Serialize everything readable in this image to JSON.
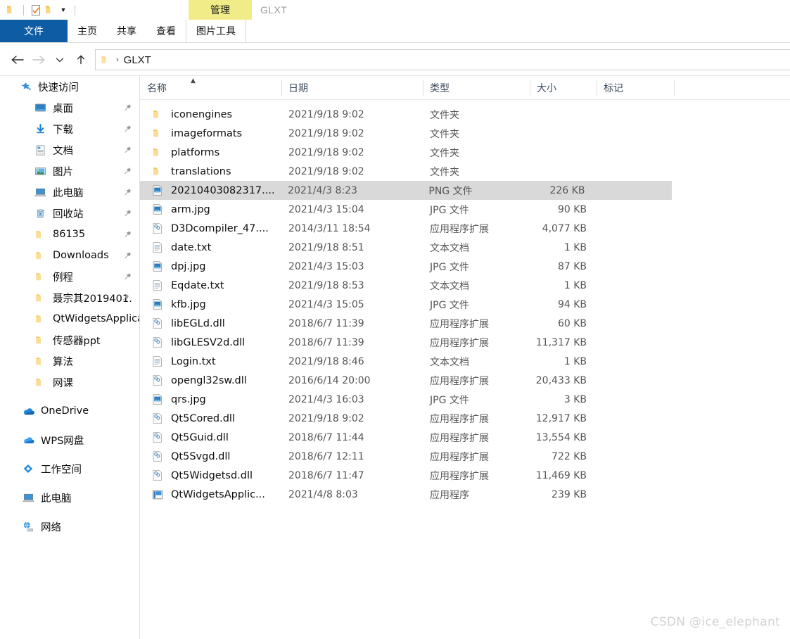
{
  "window": {
    "title": "GLXT",
    "contextual_tab_group": "管理"
  },
  "quick_access_toolbar": {
    "items": [
      {
        "name": "folder-icon",
        "label": "属性"
      },
      {
        "name": "properties-icon",
        "label": "属性"
      },
      {
        "name": "new-folder-icon",
        "label": "新建文件夹"
      }
    ],
    "customize_label": "自定义快速访问工具栏"
  },
  "ribbon": {
    "tabs": [
      {
        "label": "文件",
        "active": true
      },
      {
        "label": "主页",
        "active": false
      },
      {
        "label": "共享",
        "active": false
      },
      {
        "label": "查看",
        "active": false
      },
      {
        "label": "图片工具",
        "active": false,
        "contextual": true
      }
    ],
    "accent_blue": "#0d5ca4",
    "contextual_yellow": "#f1ec88"
  },
  "navigation": {
    "back_label": "后退",
    "forward_label": "前进",
    "recent_label": "最近浏览的位置",
    "up_label": "上移一级",
    "address": {
      "crumb": "GLXT",
      "separator": "›"
    }
  },
  "sidebar": {
    "groups": [
      {
        "root": {
          "label": "快速访问",
          "icon": "star-pin-icon"
        },
        "items": [
          {
            "label": "桌面",
            "icon": "desktop-icon",
            "pinned": true
          },
          {
            "label": "下载",
            "icon": "downloads-icon",
            "pinned": true
          },
          {
            "label": "文档",
            "icon": "documents-icon",
            "pinned": true
          },
          {
            "label": "图片",
            "icon": "pictures-icon",
            "pinned": true
          },
          {
            "label": "此电脑",
            "icon": "this-pc-icon",
            "pinned": true
          },
          {
            "label": "回收站",
            "icon": "recycle-bin-icon",
            "pinned": true
          },
          {
            "label": "86135",
            "icon": "folder-icon",
            "pinned": true
          },
          {
            "label": "Downloads",
            "icon": "folder-icon",
            "pinned": true
          },
          {
            "label": "例程",
            "icon": "folder-icon",
            "pinned": true
          },
          {
            "label": "聂宗其2019401…",
            "icon": "folder-icon",
            "pinned": true
          },
          {
            "label": "QtWidgetsApplica",
            "icon": "folder-icon",
            "pinned": false
          },
          {
            "label": "传感器ppt",
            "icon": "folder-icon",
            "pinned": false
          },
          {
            "label": "算法",
            "icon": "folder-icon",
            "pinned": false
          },
          {
            "label": "网课",
            "icon": "folder-icon",
            "pinned": false
          }
        ]
      },
      {
        "root": {
          "label": "OneDrive",
          "icon": "onedrive-icon"
        },
        "items": []
      },
      {
        "root": {
          "label": "WPS网盘",
          "icon": "wps-cloud-icon"
        },
        "items": []
      },
      {
        "root": {
          "label": "工作空间",
          "icon": "workspace-icon"
        },
        "items": []
      },
      {
        "root": {
          "label": "此电脑",
          "icon": "this-pc-icon"
        },
        "items": []
      },
      {
        "root": {
          "label": "网络",
          "icon": "network-icon"
        },
        "items": []
      }
    ]
  },
  "file_list": {
    "columns": [
      {
        "label": "名称",
        "key": "name",
        "sorted": "asc"
      },
      {
        "label": "日期",
        "key": "date"
      },
      {
        "label": "类型",
        "key": "type"
      },
      {
        "label": "大小",
        "key": "size"
      },
      {
        "label": "标记",
        "key": "tag"
      }
    ],
    "rows": [
      {
        "name": "iconengines",
        "date": "2021/9/18 9:02",
        "type": "文件夹",
        "size": "",
        "tag": "",
        "icon": "folder-icon",
        "selected": false
      },
      {
        "name": "imageformats",
        "date": "2021/9/18 9:02",
        "type": "文件夹",
        "size": "",
        "tag": "",
        "icon": "folder-icon",
        "selected": false
      },
      {
        "name": "platforms",
        "date": "2021/9/18 9:02",
        "type": "文件夹",
        "size": "",
        "tag": "",
        "icon": "folder-icon",
        "selected": false
      },
      {
        "name": "translations",
        "date": "2021/9/18 9:02",
        "type": "文件夹",
        "size": "",
        "tag": "",
        "icon": "folder-icon",
        "selected": false
      },
      {
        "name": "20210403082317....",
        "date": "2021/4/3 8:23",
        "type": "PNG 文件",
        "size": "226 KB",
        "tag": "",
        "icon": "image-icon",
        "selected": true
      },
      {
        "name": "arm.jpg",
        "date": "2021/4/3 15:04",
        "type": "JPG 文件",
        "size": "90 KB",
        "tag": "",
        "icon": "image-icon",
        "selected": false
      },
      {
        "name": "D3Dcompiler_47....",
        "date": "2014/3/11 18:54",
        "type": "应用程序扩展",
        "size": "4,077 KB",
        "tag": "",
        "icon": "dll-icon",
        "selected": false
      },
      {
        "name": "date.txt",
        "date": "2021/9/18 8:51",
        "type": "文本文档",
        "size": "1 KB",
        "tag": "",
        "icon": "text-icon",
        "selected": false
      },
      {
        "name": "dpj.jpg",
        "date": "2021/4/3 15:03",
        "type": "JPG 文件",
        "size": "87 KB",
        "tag": "",
        "icon": "image-icon",
        "selected": false
      },
      {
        "name": "Eqdate.txt",
        "date": "2021/9/18 8:53",
        "type": "文本文档",
        "size": "1 KB",
        "tag": "",
        "icon": "text-icon",
        "selected": false
      },
      {
        "name": "kfb.jpg",
        "date": "2021/4/3 15:05",
        "type": "JPG 文件",
        "size": "94 KB",
        "tag": "",
        "icon": "image-icon",
        "selected": false
      },
      {
        "name": "libEGLd.dll",
        "date": "2018/6/7 11:39",
        "type": "应用程序扩展",
        "size": "60 KB",
        "tag": "",
        "icon": "dll-icon",
        "selected": false
      },
      {
        "name": "libGLESV2d.dll",
        "date": "2018/6/7 11:39",
        "type": "应用程序扩展",
        "size": "11,317 KB",
        "tag": "",
        "icon": "dll-icon",
        "selected": false
      },
      {
        "name": "Login.txt",
        "date": "2021/9/18 8:46",
        "type": "文本文档",
        "size": "1 KB",
        "tag": "",
        "icon": "text-icon",
        "selected": false
      },
      {
        "name": "opengl32sw.dll",
        "date": "2016/6/14 20:00",
        "type": "应用程序扩展",
        "size": "20,433 KB",
        "tag": "",
        "icon": "dll-icon",
        "selected": false
      },
      {
        "name": "qrs.jpg",
        "date": "2021/4/3 16:03",
        "type": "JPG 文件",
        "size": "3 KB",
        "tag": "",
        "icon": "image-icon",
        "selected": false
      },
      {
        "name": "Qt5Cored.dll",
        "date": "2021/9/18 9:02",
        "type": "应用程序扩展",
        "size": "12,917 KB",
        "tag": "",
        "icon": "dll-icon",
        "selected": false
      },
      {
        "name": "Qt5Guid.dll",
        "date": "2018/6/7 11:44",
        "type": "应用程序扩展",
        "size": "13,554 KB",
        "tag": "",
        "icon": "dll-icon",
        "selected": false
      },
      {
        "name": "Qt5Svgd.dll",
        "date": "2018/6/7 12:11",
        "type": "应用程序扩展",
        "size": "722 KB",
        "tag": "",
        "icon": "dll-icon",
        "selected": false
      },
      {
        "name": "Qt5Widgetsd.dll",
        "date": "2018/6/7 11:47",
        "type": "应用程序扩展",
        "size": "11,469 KB",
        "tag": "",
        "icon": "dll-icon",
        "selected": false
      },
      {
        "name": "QtWidgetsApplic...",
        "date": "2021/4/8 8:03",
        "type": "应用程序",
        "size": "239 KB",
        "tag": "",
        "icon": "exe-icon",
        "selected": false
      }
    ]
  },
  "watermark": {
    "text": "CSDN @ice_elephant"
  }
}
